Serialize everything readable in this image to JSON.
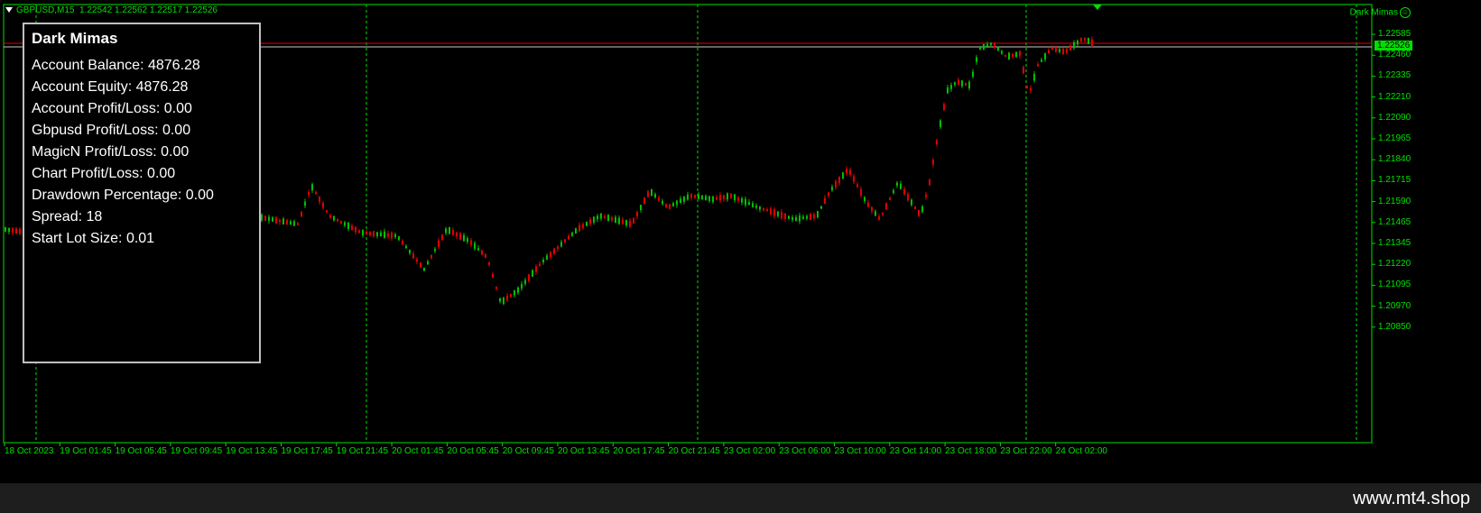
{
  "header": {
    "symbol": "GBPUSD,M15",
    "ohlc": "1.22542 1.22562 1.22517 1.22526",
    "ea_name": "Dark Mimas"
  },
  "info_panel": {
    "title": "Dark Mimas",
    "rows": [
      "Account Balance: 4876.28",
      "Account Equity: 4876.28",
      "Account Profit/Loss: 0.00",
      "Gbpusd Profit/Loss: 0.00",
      "MagicN Profit/Loss: 0.00",
      "Chart Profit/Loss: 0.00",
      "Drawdown Percentage: 0.00",
      "Spread: 18",
      "Start Lot Size: 0.01"
    ]
  },
  "price_axis": {
    "labels": [
      "1.22585",
      "1.22460",
      "1.22335",
      "1.22210",
      "1.22090",
      "1.21965",
      "1.21840",
      "1.21715",
      "1.21590",
      "1.21465",
      "1.21345",
      "1.21220",
      "1.21095",
      "1.20970",
      "1.20850"
    ],
    "current_price": "1.22526"
  },
  "time_axis": {
    "labels": [
      "18 Oct 2023",
      "19 Oct 01:45",
      "19 Oct 05:45",
      "19 Oct 09:45",
      "19 Oct 13:45",
      "19 Oct 17:45",
      "19 Oct 21:45",
      "20 Oct 01:45",
      "20 Oct 05:45",
      "20 Oct 09:45",
      "20 Oct 13:45",
      "20 Oct 17:45",
      "20 Oct 21:45",
      "23 Oct 02:00",
      "23 Oct 06:00",
      "23 Oct 10:00",
      "23 Oct 14:00",
      "23 Oct 18:00",
      "23 Oct 22:00",
      "24 Oct 02:00"
    ]
  },
  "colors": {
    "bull": "#00c000",
    "bear": "#e00000",
    "axis": "#00e000",
    "background": "#000000"
  },
  "footer": {
    "site": "www.mt4.shop"
  }
}
